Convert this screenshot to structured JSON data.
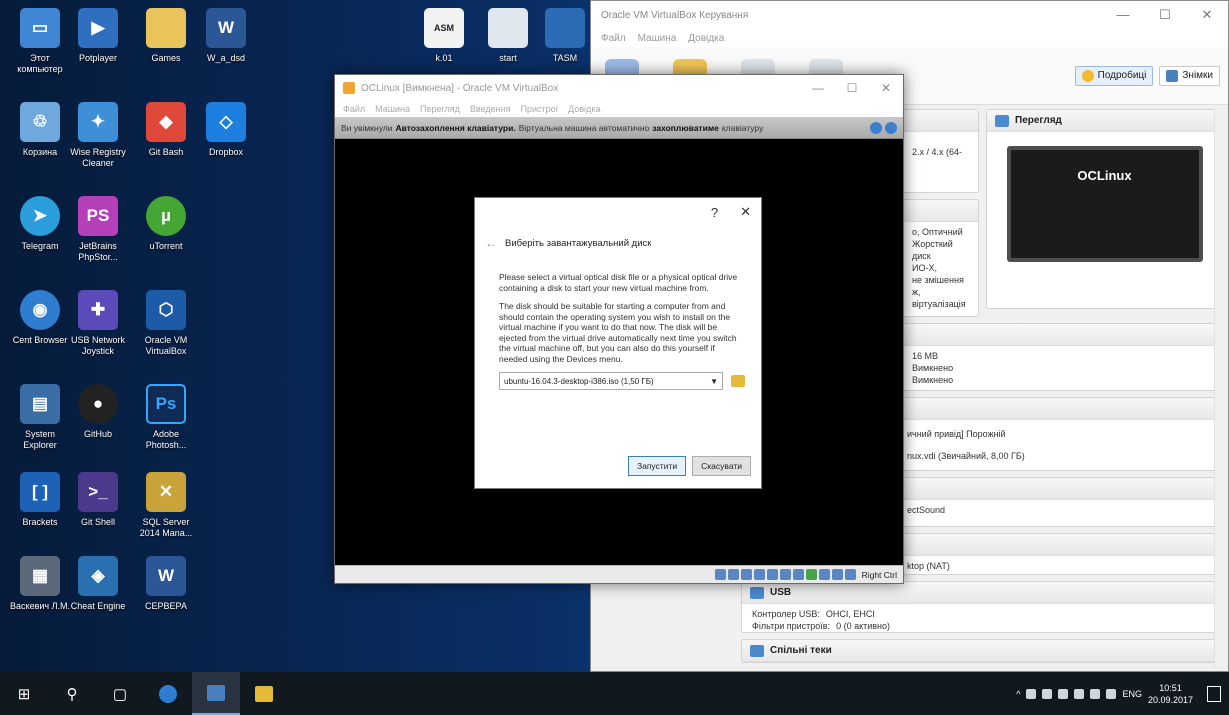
{
  "desktop": {
    "icons": [
      {
        "label": "Этот компьютер",
        "color": "#3f86d4"
      },
      {
        "label": "Potplayer",
        "color": "#2f6fbf"
      },
      {
        "label": "Games",
        "color": "#e9c45a"
      },
      {
        "label": "W_a_dsd",
        "color": "#2b5797"
      },
      {
        "label": "Корзина",
        "color": "#6fa8dc"
      },
      {
        "label": "Wise Registry Cleaner",
        "color": "#3f8fd8"
      },
      {
        "label": "Git Bash",
        "color": "#e0493a"
      },
      {
        "label": "Dropbox",
        "color": "#1d7fe0"
      },
      {
        "label": "Telegram",
        "color": "#2a9ddb"
      },
      {
        "label": "JetBrains PhpStor...",
        "color": "#b53fb8"
      },
      {
        "label": "uTorrent",
        "color": "#46a634"
      },
      {
        "label": "Cent Browser",
        "color": "#2f7dd1"
      },
      {
        "label": "USB Network Joystick",
        "color": "#5b4bb8"
      },
      {
        "label": "Oracle VM VirtualBox",
        "color": "#1d5aa8"
      },
      {
        "label": "System Explorer",
        "color": "#3a6ea5"
      },
      {
        "label": "GitHub",
        "color": "#222222"
      },
      {
        "label": "Adobe Photosh...",
        "color": "#0f2a55"
      },
      {
        "label": "Brackets",
        "color": "#1e62b8"
      },
      {
        "label": "Git Shell",
        "color": "#4b3a8c"
      },
      {
        "label": "SQL Server 2014 Mana...",
        "color": "#c8a33a"
      },
      {
        "label": "Васкевич Л.М.",
        "color": "#5a6a7a"
      },
      {
        "label": "Cheat Engine",
        "color": "#2a6fb0"
      },
      {
        "label": "СЕРВЕРА",
        "color": "#2b5797"
      }
    ],
    "top_icons": [
      {
        "label": "k.01"
      },
      {
        "label": "start"
      },
      {
        "label": "TASM"
      }
    ]
  },
  "manager": {
    "title": "Oracle VM VirtualBox Керування",
    "menu": [
      "Файл",
      "Машина",
      "Довідка"
    ],
    "mode_details": "Подробиці",
    "mode_snapshots": "Знімки",
    "preview_head": "Перегляд",
    "preview_vm": "OCLinux",
    "general_fragment": "2.x / 4.x (64-",
    "system_fragment": [
      "о, Оптичний",
      "Жорсткий диск",
      "ИО-Х,",
      "не змішення",
      "ж,",
      "віртуалізація"
    ],
    "display_fragment": [
      "16 MB",
      "Вимкнено",
      "Вимкнено"
    ],
    "storage_fragment": [
      "ичний привід] Порожній",
      "nux.vdi (Звичайний, 8,00 ГБ)"
    ],
    "audio_fragment": "ectSound",
    "network_fragment": "ktop (NAT)",
    "usb_head": "USB",
    "usb_controller_label": "Контролер USB:",
    "usb_controller_value": "OHCI, EHCI",
    "usb_filters_label": "Фільтри пристроїв:",
    "usb_filters_value": "0 (0 активно)",
    "shared_head": "Спільні теки"
  },
  "vm_window": {
    "title": "OCLinux [Вимкнена] - Oracle VM VirtualBox",
    "menu": [
      "Файл",
      "Машина",
      "Перегляд",
      "Введення",
      "Пристрої",
      "Довідка"
    ],
    "notice_pre": "Ви увімкнули",
    "notice_bold1": "Автозахоплення клавіатури.",
    "notice_mid": "Віртуальна машина автоматично",
    "notice_bold2": "захоплюватиме",
    "notice_post": "клавіатуру",
    "host_key": "Right Ctrl"
  },
  "dialog": {
    "help": "?",
    "close": "✕",
    "back": "←",
    "heading": "Виберіть завантажувальний диск",
    "para1": "Please select a virtual optical disk file or a physical optical drive containing a disk to start your new virtual machine from.",
    "para2": "The disk should be suitable for starting a computer from and should contain the operating system you wish to install on the virtual machine if you want to do that now. The disk will be ejected from the virtual drive automatically next time you switch the virtual machine off, but you can also do this yourself if needed using the Devices menu.",
    "selected_disk": "ubuntu-16.04.3-desktop-i386.iso (1,50 ГБ)",
    "start_btn": "Запустити",
    "cancel_btn": "Скасувати"
  },
  "taskbar": {
    "lang": "ENG",
    "time": "10:51",
    "date": "20.09.2017"
  }
}
